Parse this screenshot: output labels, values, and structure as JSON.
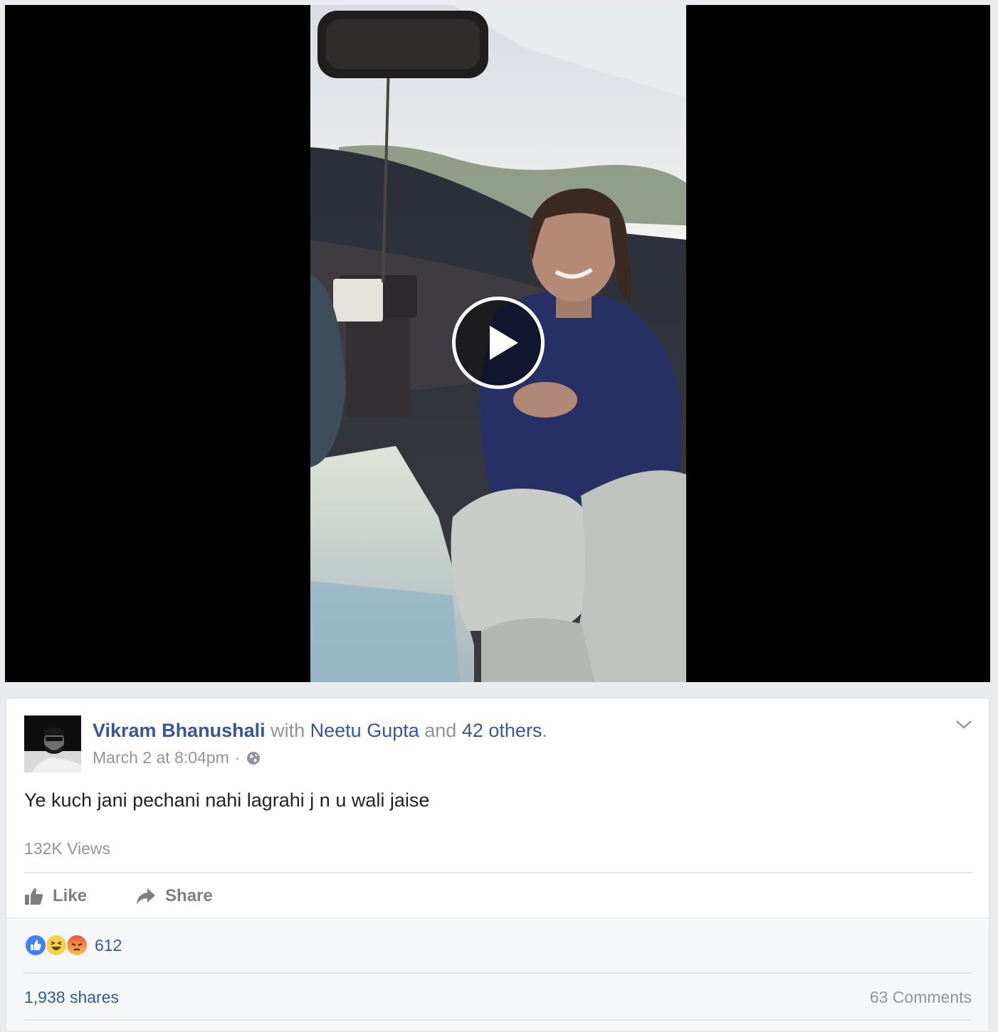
{
  "video": {
    "play_icon": "play-icon"
  },
  "post": {
    "author": "Vikram Bhanushali",
    "with_word": "with",
    "tagged_person": "Neetu Gupta",
    "and_word": "and",
    "others": "42 others",
    "period": ".",
    "timestamp": "March 2 at 8:04pm",
    "separator": "·",
    "privacy_icon": "globe-icon",
    "text": "Ye kuch jani pechani nahi lagrahi j n u wali jaise",
    "views": "132K Views"
  },
  "actions": {
    "like_label": "Like",
    "share_label": "Share"
  },
  "engagement": {
    "reactions": [
      "like-reaction-icon",
      "haha-reaction-icon",
      "angry-reaction-icon"
    ],
    "reaction_count": "612",
    "shares": "1,938 shares",
    "comments": "63 Comments"
  },
  "colors": {
    "link_blue": "#365899",
    "meta_gray": "#90949c",
    "like_blue": "#4080ff"
  }
}
